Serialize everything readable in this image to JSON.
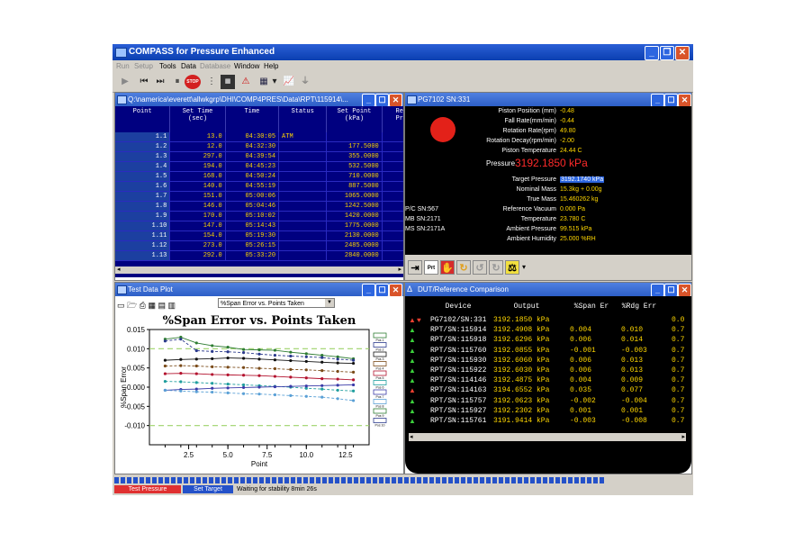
{
  "app": {
    "title": "COMPASS for Pressure Enhanced",
    "menu": [
      {
        "label": "Run",
        "enabled": false
      },
      {
        "label": "Setup",
        "enabled": false
      },
      {
        "label": "Tools",
        "enabled": true
      },
      {
        "label": "Data",
        "enabled": true
      },
      {
        "label": "Database",
        "enabled": false
      },
      {
        "label": "Window",
        "enabled": true
      },
      {
        "label": "Help",
        "enabled": true
      }
    ],
    "toolbar": {
      "stop_label": "STOP",
      "icons": [
        "play-icon",
        "skip-back-icon",
        "skip-forward-icon",
        "pause-icon",
        "stop-icon",
        "list-icon",
        "calculator-icon",
        "warning-icon",
        "table-icon",
        "chart-icon",
        "funnel-icon"
      ]
    }
  },
  "data_window": {
    "title": "Q:\\namerica\\everett\\allwkgrp\\DHI\\COMP4PRES\\Data\\RPT\\115914\\...",
    "columns": [
      {
        "label": "Point",
        "sub": ""
      },
      {
        "label": "Set Time",
        "sub": "(sec)"
      },
      {
        "label": "Time",
        "sub": ""
      },
      {
        "label": "Status",
        "sub": ""
      },
      {
        "label": "Set Point",
        "sub": "(kPa)"
      },
      {
        "label": "Ref",
        "sub": "Pre"
      }
    ],
    "rows": [
      {
        "point": "1.1",
        "set_time": "13.0",
        "time": "04:30:05",
        "status": "ATM",
        "set_point": ""
      },
      {
        "point": "1.2",
        "set_time": "12.0",
        "time": "04:32:30",
        "status": "",
        "set_point": "177.5000"
      },
      {
        "point": "1.3",
        "set_time": "297.0",
        "time": "04:39:54",
        "status": "",
        "set_point": "355.0000"
      },
      {
        "point": "1.4",
        "set_time": "194.0",
        "time": "04:45:23",
        "status": "",
        "set_point": "532.5000"
      },
      {
        "point": "1.5",
        "set_time": "168.0",
        "time": "04:50:24",
        "status": "",
        "set_point": "710.0000"
      },
      {
        "point": "1.6",
        "set_time": "140.0",
        "time": "04:55:19",
        "status": "",
        "set_point": "887.5000"
      },
      {
        "point": "1.7",
        "set_time": "151.0",
        "time": "05:00:06",
        "status": "",
        "set_point": "1065.0000"
      },
      {
        "point": "1.8",
        "set_time": "146.0",
        "time": "05:04:46",
        "status": "",
        "set_point": "1242.5000"
      },
      {
        "point": "1.9",
        "set_time": "170.0",
        "time": "05:10:02",
        "status": "",
        "set_point": "1420.0000"
      },
      {
        "point": "1.10",
        "set_time": "147.0",
        "time": "05:14:43",
        "status": "",
        "set_point": "1775.0000"
      },
      {
        "point": "1.11",
        "set_time": "154.0",
        "time": "05:19:30",
        "status": "",
        "set_point": "2130.0000"
      },
      {
        "point": "1.12",
        "set_time": "273.0",
        "time": "05:26:15",
        "status": "",
        "set_point": "2485.0000"
      },
      {
        "point": "1.13",
        "set_time": "292.0",
        "time": "05:33:20",
        "status": "",
        "set_point": "2840.0000"
      }
    ]
  },
  "pg_window": {
    "title": "PG7102 SN:331",
    "status_light_color": "#e32119",
    "readings_top": [
      {
        "label": "Piston Position (mm)",
        "value": "-0.48"
      },
      {
        "label": "Fall Rate(mm/min)",
        "value": "-0.44"
      },
      {
        "label": "Rotation Rate(rpm)",
        "value": "49.80"
      },
      {
        "label": "Rotation Decay(rpm/min)",
        "value": "-2.00"
      },
      {
        "label": "Piston Temperature",
        "value": "24.44 C"
      }
    ],
    "pressure_label": "Pressure",
    "pressure_value": "3192.1850 kPa",
    "readings_bottom": [
      {
        "label": "Target Pressure",
        "value": "3192.1740 kPa"
      },
      {
        "label": "Nominal Mass",
        "value": "15.3kg + 0.00g"
      },
      {
        "label": "True Mass",
        "value": "15.460262 kg"
      },
      {
        "label": "Reference Vacuum",
        "value": "0.000 Pa"
      },
      {
        "label": "Temperature",
        "value": "23.780 C"
      },
      {
        "label": "Ambient Pressure",
        "value": "99.515 kPa"
      },
      {
        "label": "Ambient Humidity",
        "value": "25.000 %RH"
      }
    ],
    "serials": [
      "P/C SN:567",
      "MB SN:2171",
      "MS SN:2171A"
    ],
    "tool_icons": [
      "exit-icon",
      "print-icon",
      "hand-stop-icon",
      "rotate-cw-icon",
      "rotate-ccw-icon",
      "rotate-icon",
      "mass-icon"
    ]
  },
  "plot_window": {
    "title": "Test Data Plot",
    "selector_value": "%Span Error vs. Points Taken",
    "chart_data": {
      "type": "line",
      "title": "%Span Error vs. Points Taken",
      "xlabel": "Point",
      "ylabel": "%Span Error",
      "xlim": [
        0,
        14
      ],
      "ylim": [
        -0.015,
        0.015
      ],
      "x_ticks": [
        2.5,
        5.0,
        7.5,
        10.0,
        12.5
      ],
      "y_ticks": [
        0.015,
        0.01,
        0.005,
        0.0,
        -0.005,
        -0.01
      ],
      "x_tick_labels": [
        "2.5",
        "5.0",
        "7.5",
        "10.0",
        "12.5"
      ],
      "y_tick_labels": [
        "0.015",
        "0.010",
        "0.005",
        "-0.000",
        "-0.005",
        "-0.010"
      ],
      "limit_lines": [
        0.01,
        -0.01
      ],
      "limit_color": "#9ed36a",
      "x": [
        1,
        2,
        3,
        4,
        5,
        6,
        7,
        8,
        9,
        10,
        11,
        12,
        13
      ],
      "series": [
        {
          "color": "#2e7d32",
          "values": [
            0.0125,
            0.013,
            0.0115,
            0.0108,
            0.0104,
            0.0098,
            0.0097,
            0.0096,
            0.0091,
            0.0087,
            0.0083,
            0.0079,
            0.0074
          ]
        },
        {
          "color": "#2b3a8c",
          "values": [
            0.012,
            0.0125,
            0.0095,
            0.0093,
            0.0092,
            0.009,
            0.0086,
            0.0083,
            0.0081,
            0.0079,
            0.0077,
            0.0073,
            0.007
          ]
        },
        {
          "color": "#111111",
          "values": [
            0.007,
            0.0072,
            0.0073,
            0.0074,
            0.0076,
            0.0075,
            0.0073,
            0.0071,
            0.0069,
            0.0067,
            0.0065,
            0.0063,
            0.0062
          ]
        },
        {
          "color": "#7a4a18",
          "values": [
            0.0055,
            0.0056,
            0.0055,
            0.0053,
            0.0052,
            0.0051,
            0.0049,
            0.0048,
            0.0046,
            0.0045,
            0.0043,
            0.0041,
            0.0039
          ]
        },
        {
          "color": "#b3122e",
          "values": [
            0.0035,
            0.0036,
            0.0035,
            0.0033,
            0.0032,
            0.0031,
            0.003,
            0.0028,
            0.0026,
            0.0024,
            0.0022,
            0.0021,
            0.0019
          ]
        },
        {
          "color": "#1f9e9e",
          "values": [
            0.0015,
            0.0014,
            0.0012,
            0.001,
            0.0008,
            0.0006,
            0.0004,
            0.0002,
            0.0,
            -0.0003,
            -0.0005,
            -0.0008,
            -0.001
          ]
        },
        {
          "color": "#3a3aa8",
          "values": [
            -0.0008,
            -0.0006,
            -0.0005,
            -0.0003,
            -0.0002,
            -0.0001,
            0.0,
            0.0001,
            0.0002,
            0.0003,
            0.0004,
            0.0005,
            0.0006
          ]
        },
        {
          "color": "#5aa0d6",
          "values": [
            -0.0008,
            -0.001,
            -0.0012,
            -0.0013,
            -0.0015,
            -0.0017,
            -0.0018,
            -0.002,
            -0.0022,
            -0.0024,
            -0.0026,
            -0.003,
            -0.0035
          ]
        }
      ],
      "legend": [
        "Pos 1",
        "Pos 2",
        "Pos 3",
        "Pos 4",
        "Pos 5",
        "Pos 6",
        "Pos 7",
        "Pos 8",
        "Pos 9",
        "Pos 10"
      ]
    }
  },
  "dut_window": {
    "title": "DUT/Reference Comparison",
    "headers": [
      "Device",
      "Output",
      "%Span Er",
      "%Rdg Err"
    ],
    "rows": [
      {
        "status": "alarm",
        "device": "PG7102/SN:331",
        "output": "3192.1850 kPa",
        "span": "",
        "rdg": "",
        "extra": "0.0"
      },
      {
        "status": "ok",
        "device": "RPT/SN:115914",
        "output": "3192.4908 kPa",
        "span": "0.004",
        "rdg": "0.010",
        "extra": "0.7"
      },
      {
        "status": "ok",
        "device": "RPT/SN:115918",
        "output": "3192.6296 kPa",
        "span": "0.006",
        "rdg": "0.014",
        "extra": "0.7"
      },
      {
        "status": "ok",
        "device": "RPT/SN:115760",
        "output": "3192.0855 kPa",
        "span": "-0.001",
        "rdg": "-0.003",
        "extra": "0.7"
      },
      {
        "status": "ok",
        "device": "RPT/SN:115930",
        "output": "3192.6060 kPa",
        "span": "0.006",
        "rdg": "0.013",
        "extra": "0.7"
      },
      {
        "status": "ok",
        "device": "RPT/SN:115922",
        "output": "3192.6030 kPa",
        "span": "0.006",
        "rdg": "0.013",
        "extra": "0.7"
      },
      {
        "status": "ok",
        "device": "RPT/SN:114146",
        "output": "3192.4875 kPa",
        "span": "0.004",
        "rdg": "0.009",
        "extra": "0.7"
      },
      {
        "status": "warn",
        "device": "RPT/SN:114163",
        "output": "3194.6552 kPa",
        "span": "0.035",
        "rdg": "0.077",
        "extra": "0.7"
      },
      {
        "status": "ok",
        "device": "RPT/SN:115757",
        "output": "3192.0623 kPa",
        "span": "-0.002",
        "rdg": "-0.004",
        "extra": "0.7"
      },
      {
        "status": "ok",
        "device": "RPT/SN:115927",
        "output": "3192.2302 kPa",
        "span": "0.001",
        "rdg": "0.001",
        "extra": "0.7"
      },
      {
        "status": "ok",
        "device": "RPT/SN:115761",
        "output": "3191.9414 kPa",
        "span": "-0.003",
        "rdg": "-0.008",
        "extra": "0.7"
      }
    ]
  },
  "status_bar": {
    "test_pressure_label": "Test Pressure",
    "set_target_label": "Set Target",
    "message": "Waiting for stability  8min 26s",
    "progress_fraction": 0.85
  }
}
